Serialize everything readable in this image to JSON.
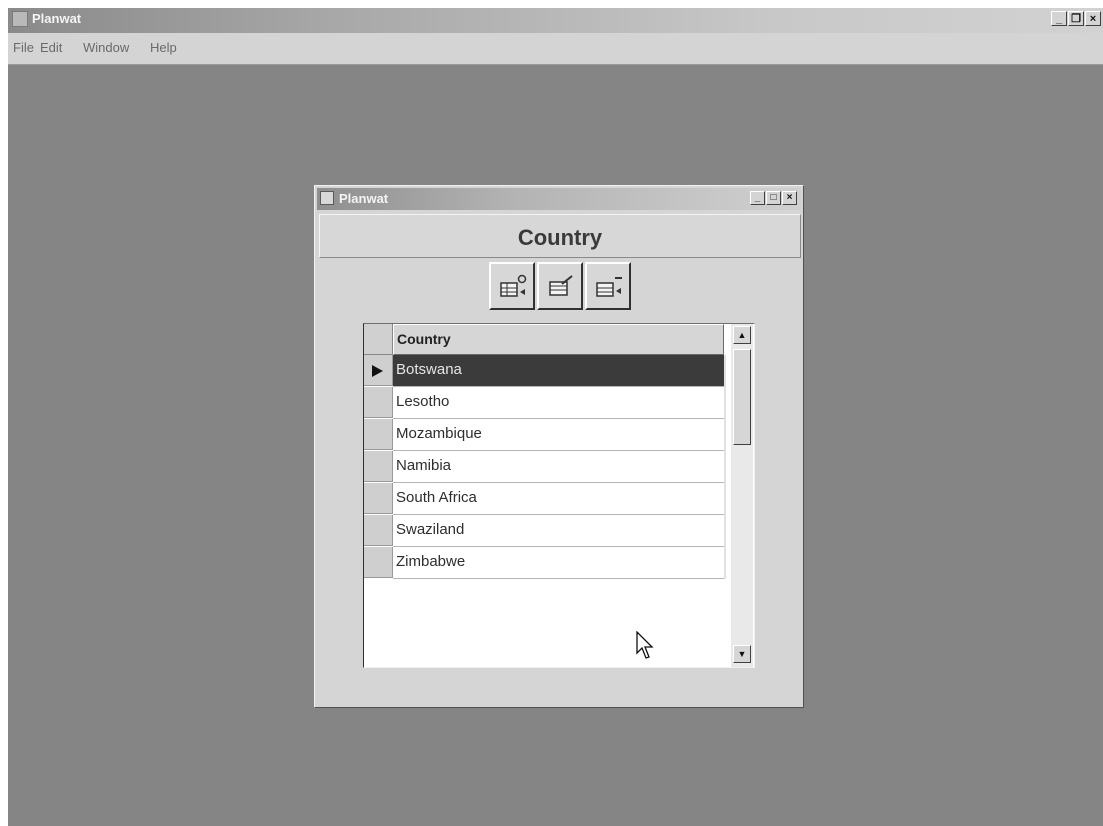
{
  "app": {
    "title": "Planwat",
    "controls": {
      "minimize": "_",
      "restore": "❐",
      "close": "×"
    },
    "menu": [
      "File",
      "Edit",
      "Window",
      "Help"
    ]
  },
  "dialog": {
    "title": "Planwat",
    "controls": {
      "minimize": "_",
      "maximize": "□",
      "close": "×"
    },
    "header": "Country",
    "toolbar": [
      {
        "name": "add-record-button"
      },
      {
        "name": "edit-record-button"
      },
      {
        "name": "delete-record-button"
      }
    ],
    "grid": {
      "column": "Country",
      "rows": [
        "Botswana",
        "Lesotho",
        "Mozambique",
        "Namibia",
        "South Africa",
        "Swaziland",
        "Zimbabwe"
      ],
      "selected_index": 0
    },
    "scroll_up": "▲",
    "scroll_down": "▼"
  },
  "colors": {
    "desktop": "#858585",
    "window_face": "#d5d5d5",
    "selection": "#3b3b3b"
  }
}
